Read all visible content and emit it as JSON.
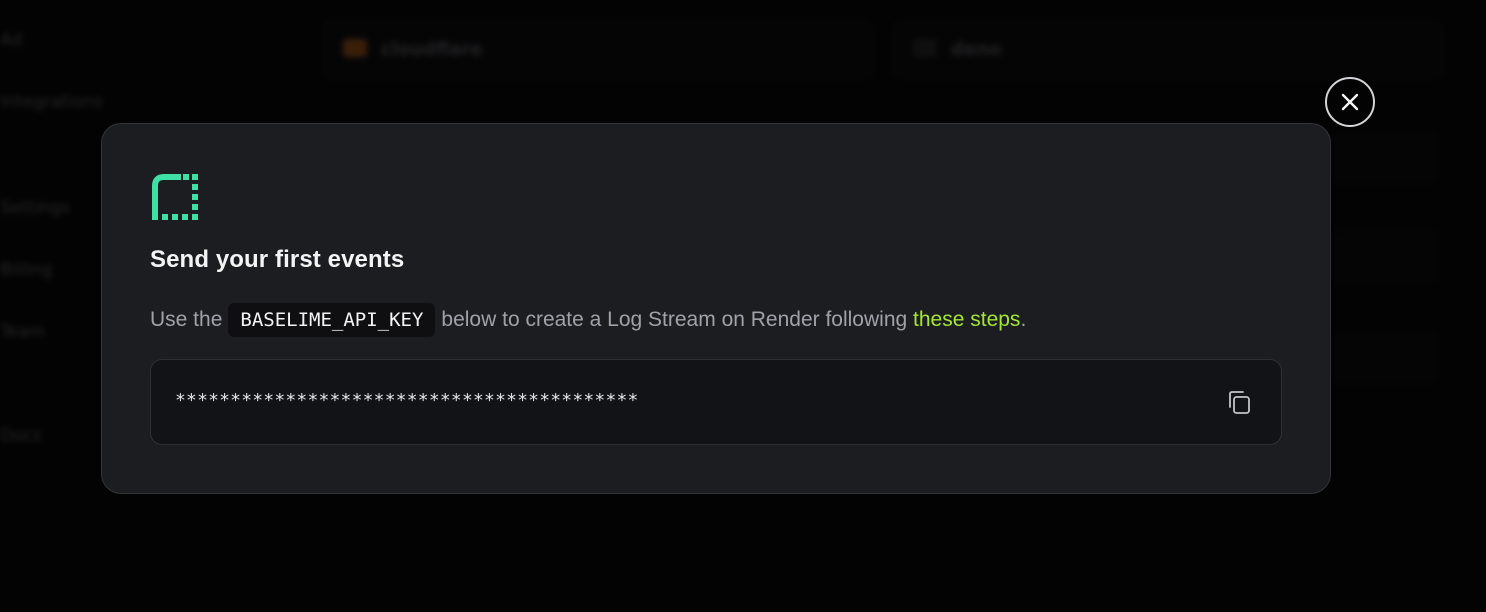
{
  "background": {
    "sidebar_items": [
      "Ad",
      "Integrations",
      "Settings",
      "Billing",
      "Team",
      "Docs"
    ],
    "cards": [
      {
        "label": "cloudflare",
        "icon": "cloudflare-icon",
        "color": "#f38020"
      },
      {
        "label": "deno",
        "icon": "deno-icon",
        "color": "#3a3a3a"
      }
    ]
  },
  "modal": {
    "title": "Send your first events",
    "description": {
      "prefix": "Use the",
      "code": "BASELIME_API_KEY",
      "middle": "below to create a Log Stream on Render following",
      "link": "these steps",
      "suffix": "."
    },
    "api_key_masked": "******************************************",
    "copy_icon": "copy-icon",
    "close_icon": "close-icon",
    "logo_icon": "baselime-logo-icon"
  },
  "colors": {
    "accent_logo": "#3ee0a6",
    "link": "#a3e635",
    "modal_bg": "#1c1d21",
    "page_bg": "#050506"
  }
}
